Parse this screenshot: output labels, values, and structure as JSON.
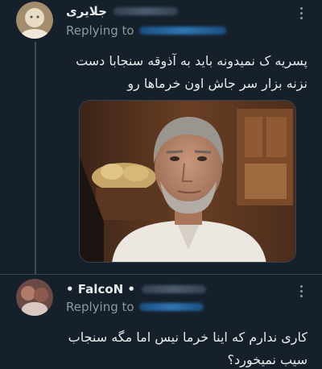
{
  "tweet1": {
    "display_name": "جلایری",
    "replying_prefix": "Replying to",
    "text": "پسریه ک نمیدونه باید به آذوقه سنجابا دست نزنه بزار سر جاش اون خرماها رو",
    "avatar_icon": "profile-avatar",
    "more_icon": "more-vertical-icon"
  },
  "tweet2": {
    "display_name": "• FalcoN •",
    "replying_prefix": "Replying to",
    "text": "کاری ندارم که اینا خرما نیس اما مگه سنجاب سیب نمیخورد؟",
    "avatar_icon": "profile-avatar",
    "more_icon": "more-vertical-icon"
  },
  "colors": {
    "background": "#15202b",
    "text": "#e7e9ea",
    "secondary": "#8b98a5",
    "link": "#1d9bf0",
    "divider": "#38444d"
  }
}
